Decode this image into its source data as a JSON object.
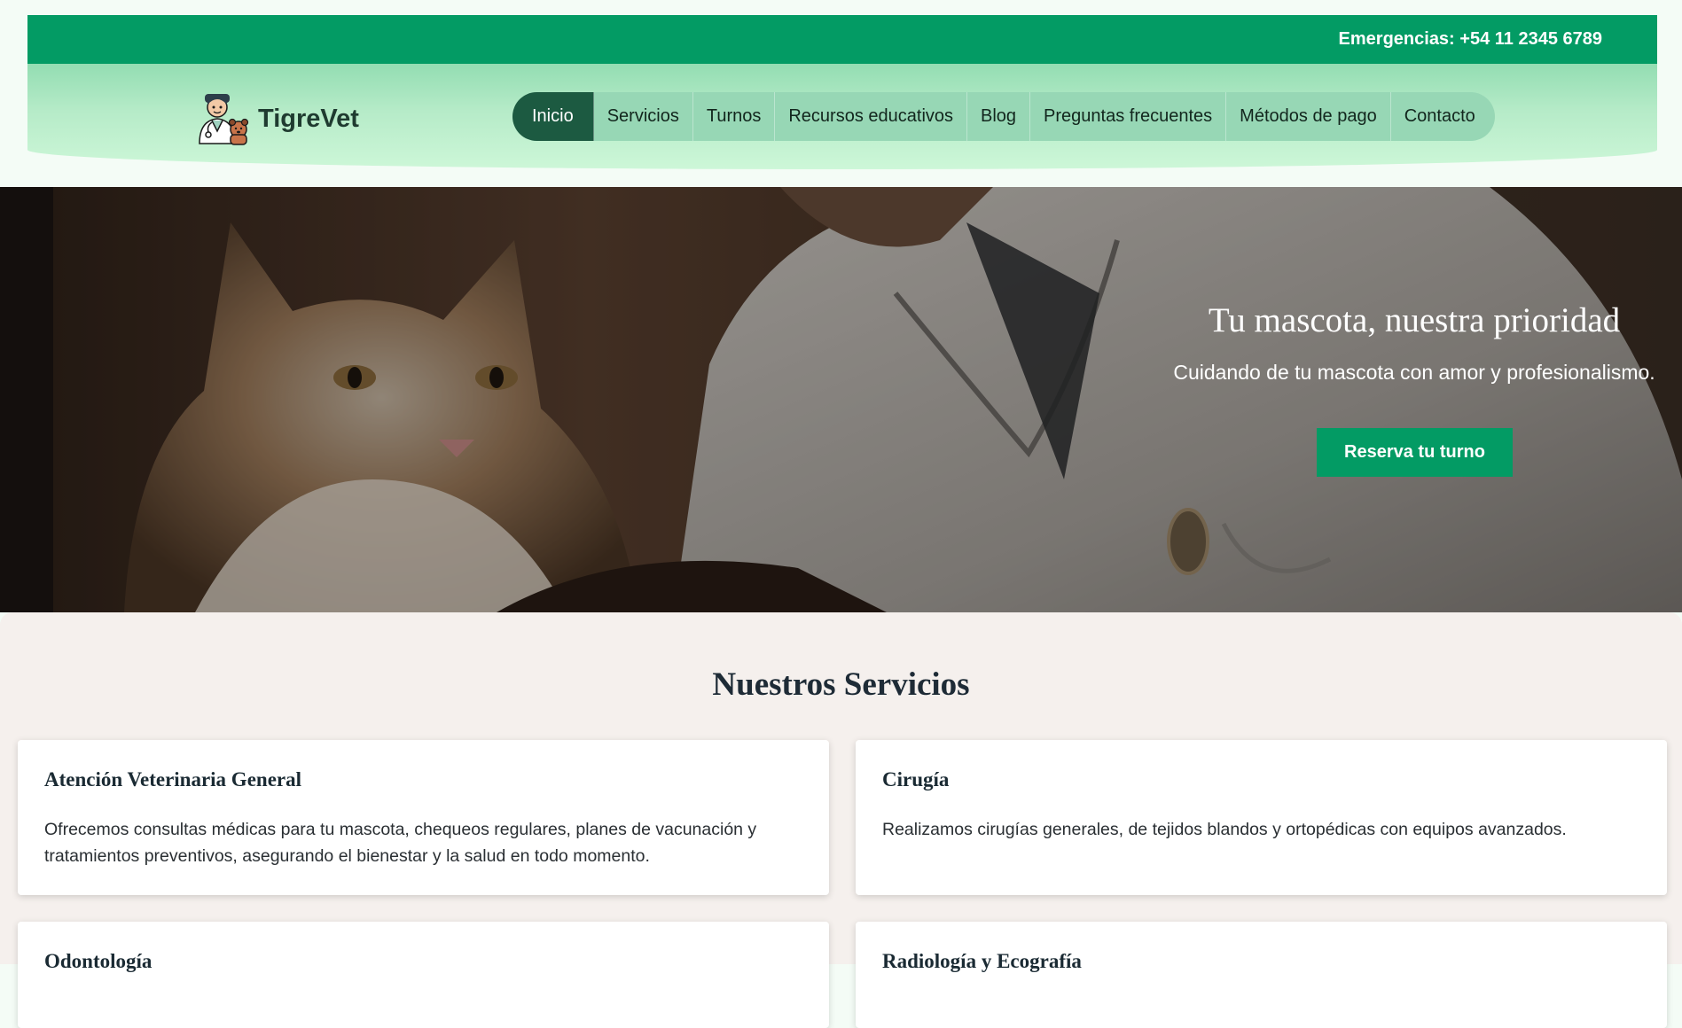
{
  "header": {
    "emergency_text": "Emergencias: +54 11 2345 6789",
    "brand_name": "TigreVet",
    "nav": [
      {
        "label": "Inicio",
        "active": true
      },
      {
        "label": "Servicios"
      },
      {
        "label": "Turnos"
      },
      {
        "label": "Recursos educativos"
      },
      {
        "label": "Blog"
      },
      {
        "label": "Preguntas frecuentes"
      },
      {
        "label": "Métodos de pago"
      },
      {
        "label": "Contacto"
      }
    ]
  },
  "hero": {
    "title": "Tu mascota, nuestra prioridad",
    "subtitle": "Cuidando de tu mascota con amor y profesionalismo.",
    "cta_label": "Reserva tu turno",
    "image_icon": "cat-vet-photo"
  },
  "services": {
    "title": "Nuestros Servicios",
    "cards": [
      {
        "title": "Atención Veterinaria General",
        "text": "Ofrecemos consultas médicas para tu mascota, chequeos regulares, planes de vacunación y tratamientos preventivos, asegurando el bienestar y la salud en todo momento."
      },
      {
        "title": "Cirugía",
        "text": "Realizamos cirugías generales, de tejidos blandos y ortopédicas con equipos avanzados."
      },
      {
        "title": "Odontología",
        "text": ""
      },
      {
        "title": "Radiología y Ecografía",
        "text": ""
      }
    ]
  },
  "colors": {
    "brand_green": "#039b64",
    "nav_active": "#1c5a41",
    "nav_bg": "#97d7b5",
    "section_bg": "#f5f0ed"
  }
}
